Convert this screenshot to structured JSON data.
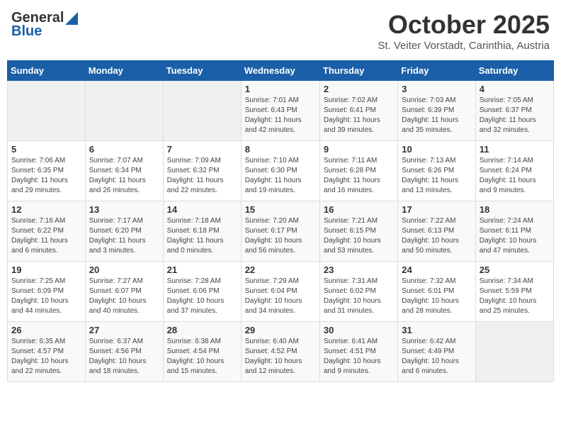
{
  "logo": {
    "general": "General",
    "blue": "Blue"
  },
  "header": {
    "month": "October 2025",
    "location": "St. Veiter Vorstadt, Carinthia, Austria"
  },
  "weekdays": [
    "Sunday",
    "Monday",
    "Tuesday",
    "Wednesday",
    "Thursday",
    "Friday",
    "Saturday"
  ],
  "weeks": [
    [
      {
        "day": "",
        "info": ""
      },
      {
        "day": "",
        "info": ""
      },
      {
        "day": "",
        "info": ""
      },
      {
        "day": "1",
        "info": "Sunrise: 7:01 AM\nSunset: 6:43 PM\nDaylight: 11 hours\nand 42 minutes."
      },
      {
        "day": "2",
        "info": "Sunrise: 7:02 AM\nSunset: 6:41 PM\nDaylight: 11 hours\nand 39 minutes."
      },
      {
        "day": "3",
        "info": "Sunrise: 7:03 AM\nSunset: 6:39 PM\nDaylight: 11 hours\nand 35 minutes."
      },
      {
        "day": "4",
        "info": "Sunrise: 7:05 AM\nSunset: 6:37 PM\nDaylight: 11 hours\nand 32 minutes."
      }
    ],
    [
      {
        "day": "5",
        "info": "Sunrise: 7:06 AM\nSunset: 6:35 PM\nDaylight: 11 hours\nand 29 minutes."
      },
      {
        "day": "6",
        "info": "Sunrise: 7:07 AM\nSunset: 6:34 PM\nDaylight: 11 hours\nand 26 minutes."
      },
      {
        "day": "7",
        "info": "Sunrise: 7:09 AM\nSunset: 6:32 PM\nDaylight: 11 hours\nand 22 minutes."
      },
      {
        "day": "8",
        "info": "Sunrise: 7:10 AM\nSunset: 6:30 PM\nDaylight: 11 hours\nand 19 minutes."
      },
      {
        "day": "9",
        "info": "Sunrise: 7:11 AM\nSunset: 6:28 PM\nDaylight: 11 hours\nand 16 minutes."
      },
      {
        "day": "10",
        "info": "Sunrise: 7:13 AM\nSunset: 6:26 PM\nDaylight: 11 hours\nand 13 minutes."
      },
      {
        "day": "11",
        "info": "Sunrise: 7:14 AM\nSunset: 6:24 PM\nDaylight: 11 hours\nand 9 minutes."
      }
    ],
    [
      {
        "day": "12",
        "info": "Sunrise: 7:16 AM\nSunset: 6:22 PM\nDaylight: 11 hours\nand 6 minutes."
      },
      {
        "day": "13",
        "info": "Sunrise: 7:17 AM\nSunset: 6:20 PM\nDaylight: 11 hours\nand 3 minutes."
      },
      {
        "day": "14",
        "info": "Sunrise: 7:18 AM\nSunset: 6:18 PM\nDaylight: 11 hours\nand 0 minutes."
      },
      {
        "day": "15",
        "info": "Sunrise: 7:20 AM\nSunset: 6:17 PM\nDaylight: 10 hours\nand 56 minutes."
      },
      {
        "day": "16",
        "info": "Sunrise: 7:21 AM\nSunset: 6:15 PM\nDaylight: 10 hours\nand 53 minutes."
      },
      {
        "day": "17",
        "info": "Sunrise: 7:22 AM\nSunset: 6:13 PM\nDaylight: 10 hours\nand 50 minutes."
      },
      {
        "day": "18",
        "info": "Sunrise: 7:24 AM\nSunset: 6:11 PM\nDaylight: 10 hours\nand 47 minutes."
      }
    ],
    [
      {
        "day": "19",
        "info": "Sunrise: 7:25 AM\nSunset: 6:09 PM\nDaylight: 10 hours\nand 44 minutes."
      },
      {
        "day": "20",
        "info": "Sunrise: 7:27 AM\nSunset: 6:07 PM\nDaylight: 10 hours\nand 40 minutes."
      },
      {
        "day": "21",
        "info": "Sunrise: 7:28 AM\nSunset: 6:06 PM\nDaylight: 10 hours\nand 37 minutes."
      },
      {
        "day": "22",
        "info": "Sunrise: 7:29 AM\nSunset: 6:04 PM\nDaylight: 10 hours\nand 34 minutes."
      },
      {
        "day": "23",
        "info": "Sunrise: 7:31 AM\nSunset: 6:02 PM\nDaylight: 10 hours\nand 31 minutes."
      },
      {
        "day": "24",
        "info": "Sunrise: 7:32 AM\nSunset: 6:01 PM\nDaylight: 10 hours\nand 28 minutes."
      },
      {
        "day": "25",
        "info": "Sunrise: 7:34 AM\nSunset: 5:59 PM\nDaylight: 10 hours\nand 25 minutes."
      }
    ],
    [
      {
        "day": "26",
        "info": "Sunrise: 6:35 AM\nSunset: 4:57 PM\nDaylight: 10 hours\nand 22 minutes."
      },
      {
        "day": "27",
        "info": "Sunrise: 6:37 AM\nSunset: 4:56 PM\nDaylight: 10 hours\nand 18 minutes."
      },
      {
        "day": "28",
        "info": "Sunrise: 6:38 AM\nSunset: 4:54 PM\nDaylight: 10 hours\nand 15 minutes."
      },
      {
        "day": "29",
        "info": "Sunrise: 6:40 AM\nSunset: 4:52 PM\nDaylight: 10 hours\nand 12 minutes."
      },
      {
        "day": "30",
        "info": "Sunrise: 6:41 AM\nSunset: 4:51 PM\nDaylight: 10 hours\nand 9 minutes."
      },
      {
        "day": "31",
        "info": "Sunrise: 6:42 AM\nSunset: 4:49 PM\nDaylight: 10 hours\nand 6 minutes."
      },
      {
        "day": "",
        "info": ""
      }
    ]
  ]
}
